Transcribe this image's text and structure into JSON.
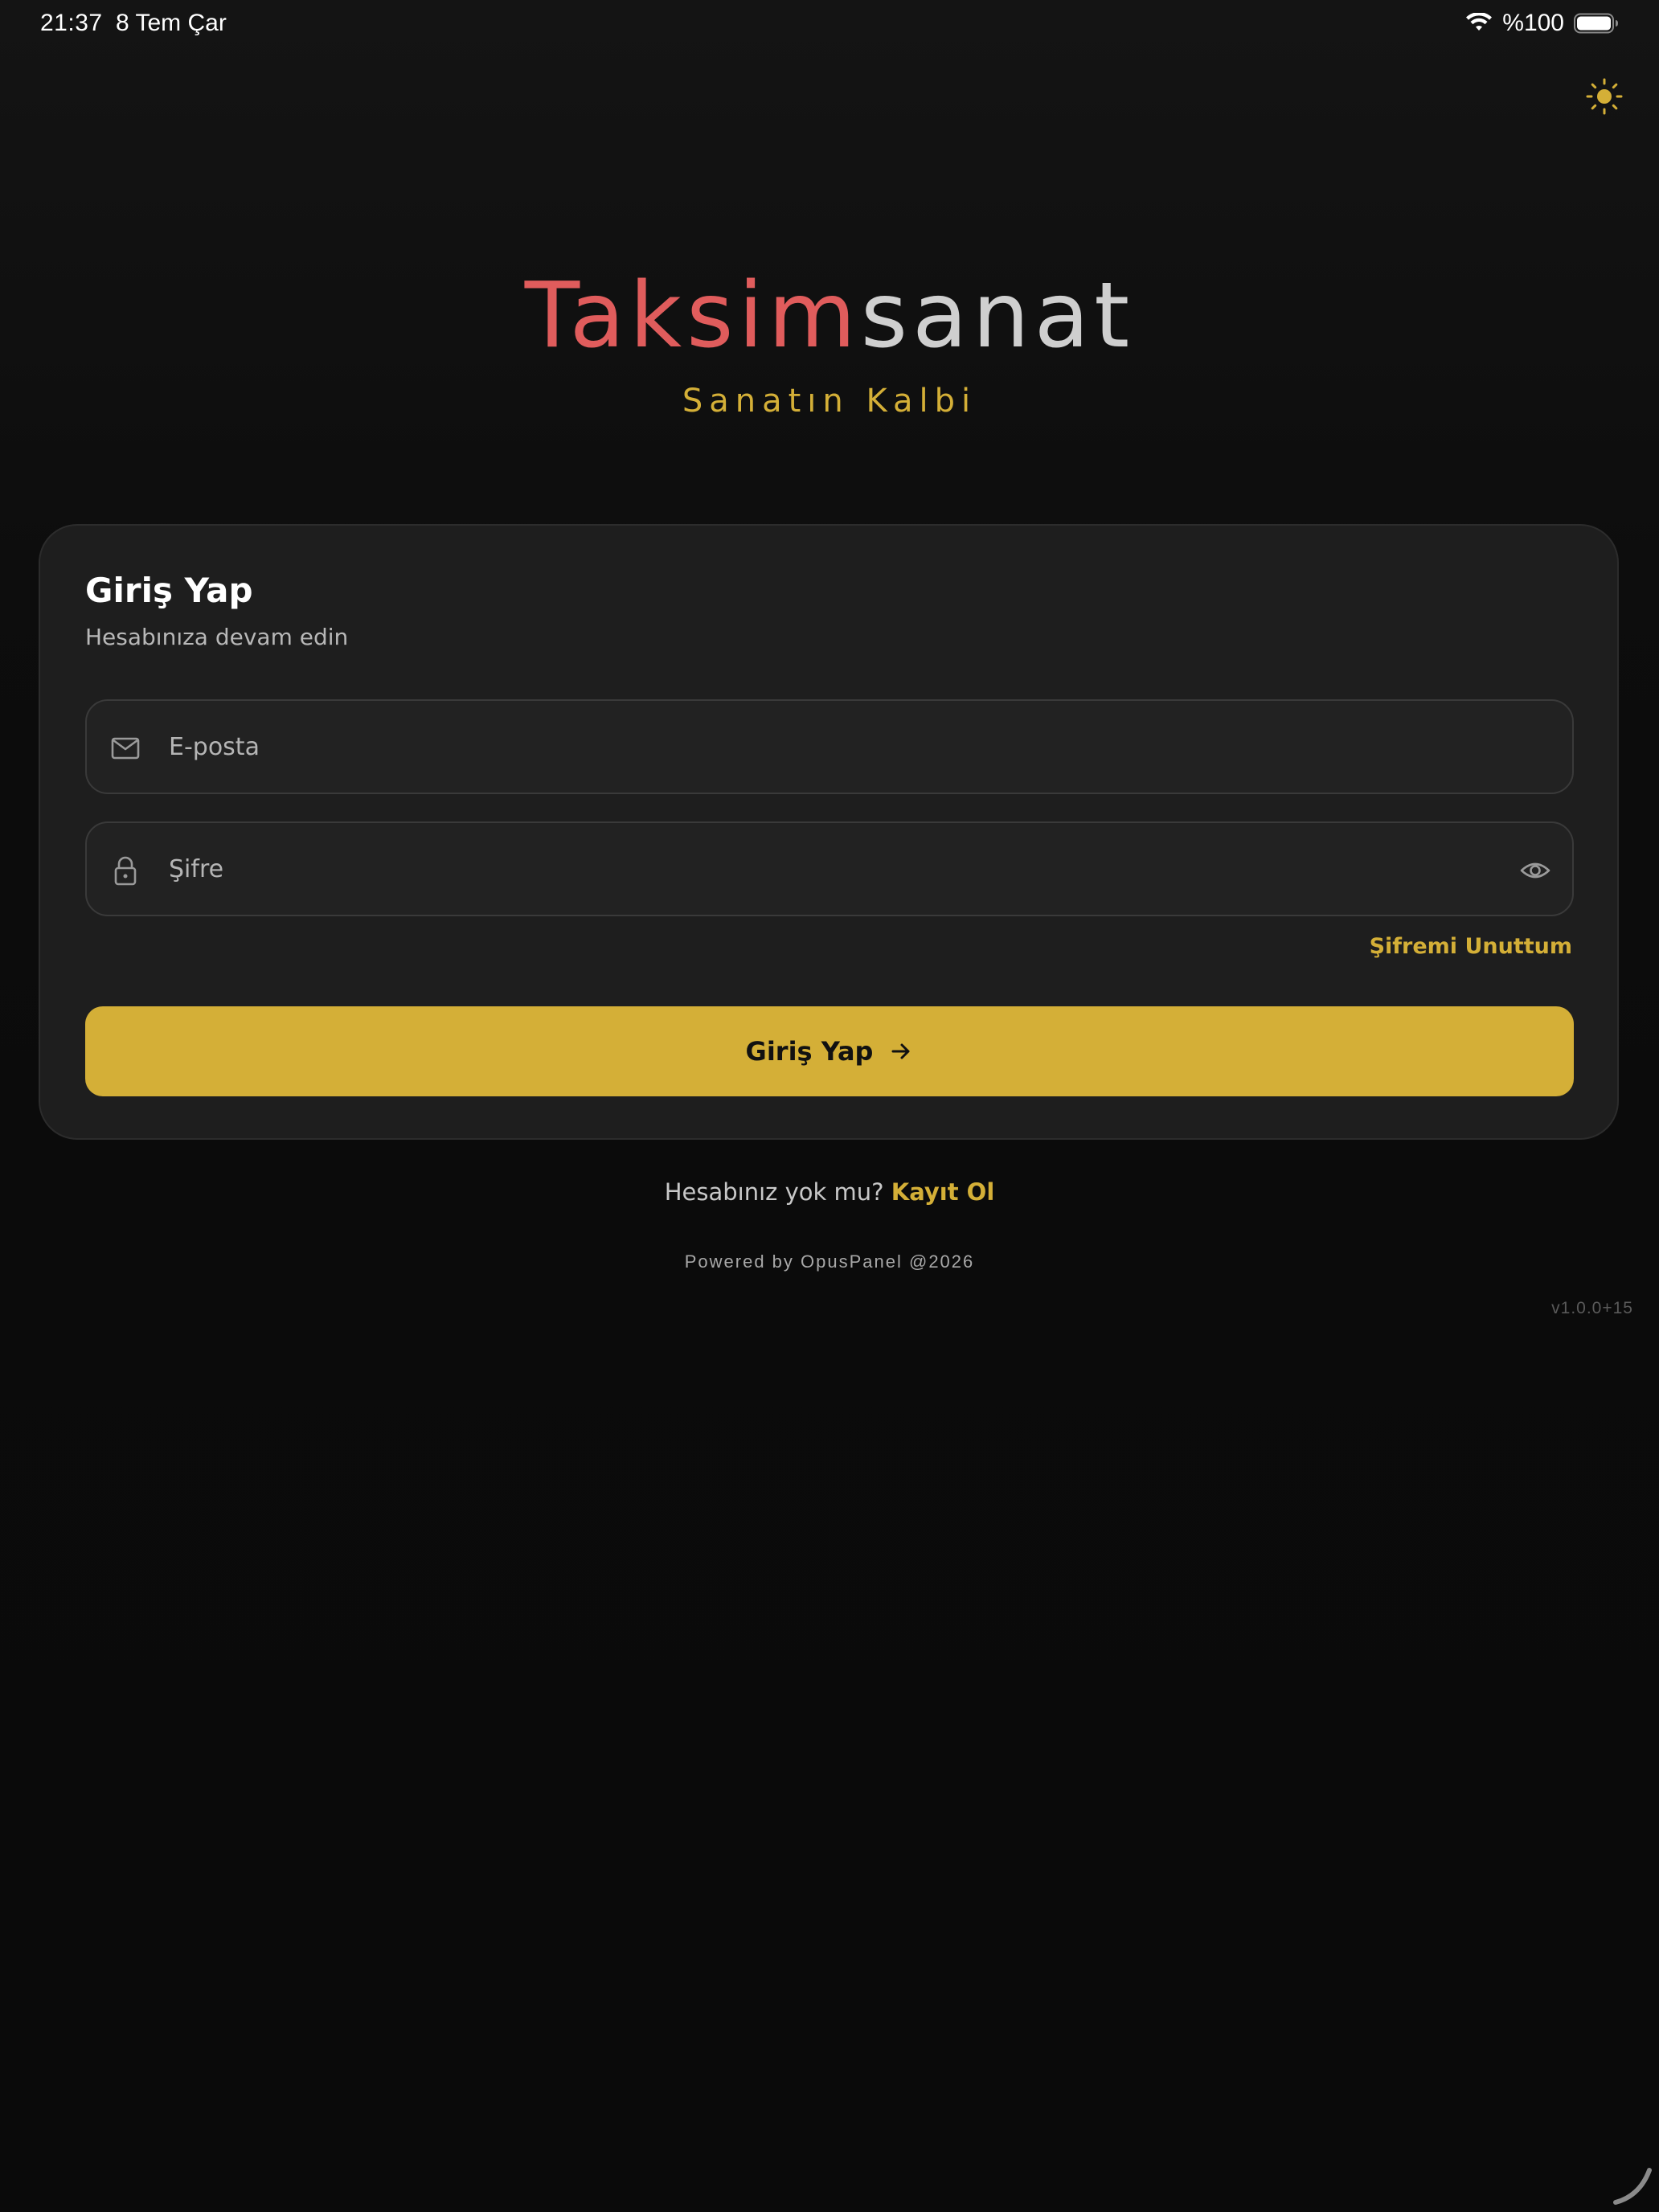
{
  "status_bar": {
    "time": "21:37",
    "date": "8 Tem Çar",
    "battery": "%100",
    "wifi_icon": "wifi-icon",
    "battery_icon": "battery-icon"
  },
  "theme_toggle": {
    "icon": "sun-icon"
  },
  "brand": {
    "title_part1": "Taksim",
    "title_part2": "sanat",
    "tagline": "Sanatın Kalbi"
  },
  "login_card": {
    "title": "Giriş Yap",
    "subtitle": "Hesabınıza devam edin",
    "email": {
      "placeholder": "E-posta",
      "value": "",
      "icon": "mail-icon"
    },
    "password": {
      "placeholder": "Şifre",
      "value": "",
      "icon": "lock-icon",
      "toggle_icon": "eye-icon"
    },
    "forgot_password": "Şifremi Unuttum",
    "submit_label": "Giriş Yap",
    "submit_icon": "arrow-right-icon"
  },
  "signup": {
    "prompt": "Hesabınız yok mu?",
    "link": "Kayıt Ol"
  },
  "footer": {
    "powered_by": "Powered by OpusPanel @2026",
    "version": "v1.0.0+15"
  },
  "colors": {
    "background": "#0b0b0b",
    "card": "#1e1e1e",
    "accent_gold": "#d4af37",
    "brand_red": "#e05c5c",
    "brand_grey": "#cfcfcf"
  }
}
